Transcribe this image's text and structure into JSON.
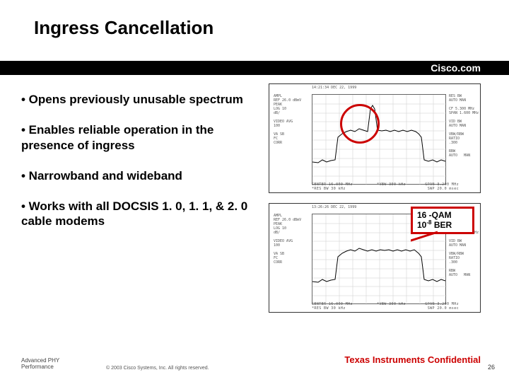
{
  "title": "Ingress Cancellation",
  "brand": "Cisco.com",
  "bullets": [
    "• Opens previously unusable spectrum",
    "• Enables reliable operation in the presence of ingress",
    "• Narrowband and wideband",
    "• Works with all DOCSIS 1. 0, 1. 1, & 2. 0 cable modems"
  ],
  "callout": {
    "line1": "16 -QAM",
    "line2_a": "10",
    "line2_sup": "-8",
    "line2_b": " BER"
  },
  "spec_top": {
    "header": "14:21:34 DEC 22, 1999",
    "left": "AMPL\nREF 26.0 dBmV\nPEAK\nLOG 10\ndB/\n\nVIDEO AVG\n100\n\nVA SB\nFC\nCORR",
    "right": "RES BW\nAUTO MAN\n\nCF 5.300 MHz\nSPAN 1.600 MHz\n\nVID BW\nAUTO MAN\n\nVBW/RBW\nRATIO\n.300\n\nRBW\nAUTO   MAN",
    "bottom": "CENTER 16.000 MHz          *VBW 300 kHz        SPAN 3.200 MHz\n*RES BW 30 kHz                                  SWP 20.0 msec"
  },
  "spec_bottom": {
    "header": "13:26:26 DEC 22, 1999",
    "left": "AMPL\nREF 26.0 dBmV\nPEAK\nLOG 10\ndB/\n\nVIDEO AVG\n100\n\nVA SB\nFC\nCORR",
    "right": "RES BW\nAUTO MAN\n\nCF 5.300 MHz\nSPAN 1.600 MHz\n\nVID BW\nAUTO MAN\n\nVBW/RBW\nRATIO\n.300\n\nRBW\nAUTO   MAN",
    "bottom": "CENTER 16.000 MHz          *VBW 300 kHz        SPAN 3.200 MHz\n*RES BW 30 kHz                                  SWP 20.0 msec"
  },
  "footer": {
    "left_l1": "Advanced PHY",
    "left_l2": "Performance",
    "copyright": "© 2003 Cisco Systems, Inc. All rights reserved.",
    "ti": "Texas Instruments Confidential",
    "page": "26"
  }
}
